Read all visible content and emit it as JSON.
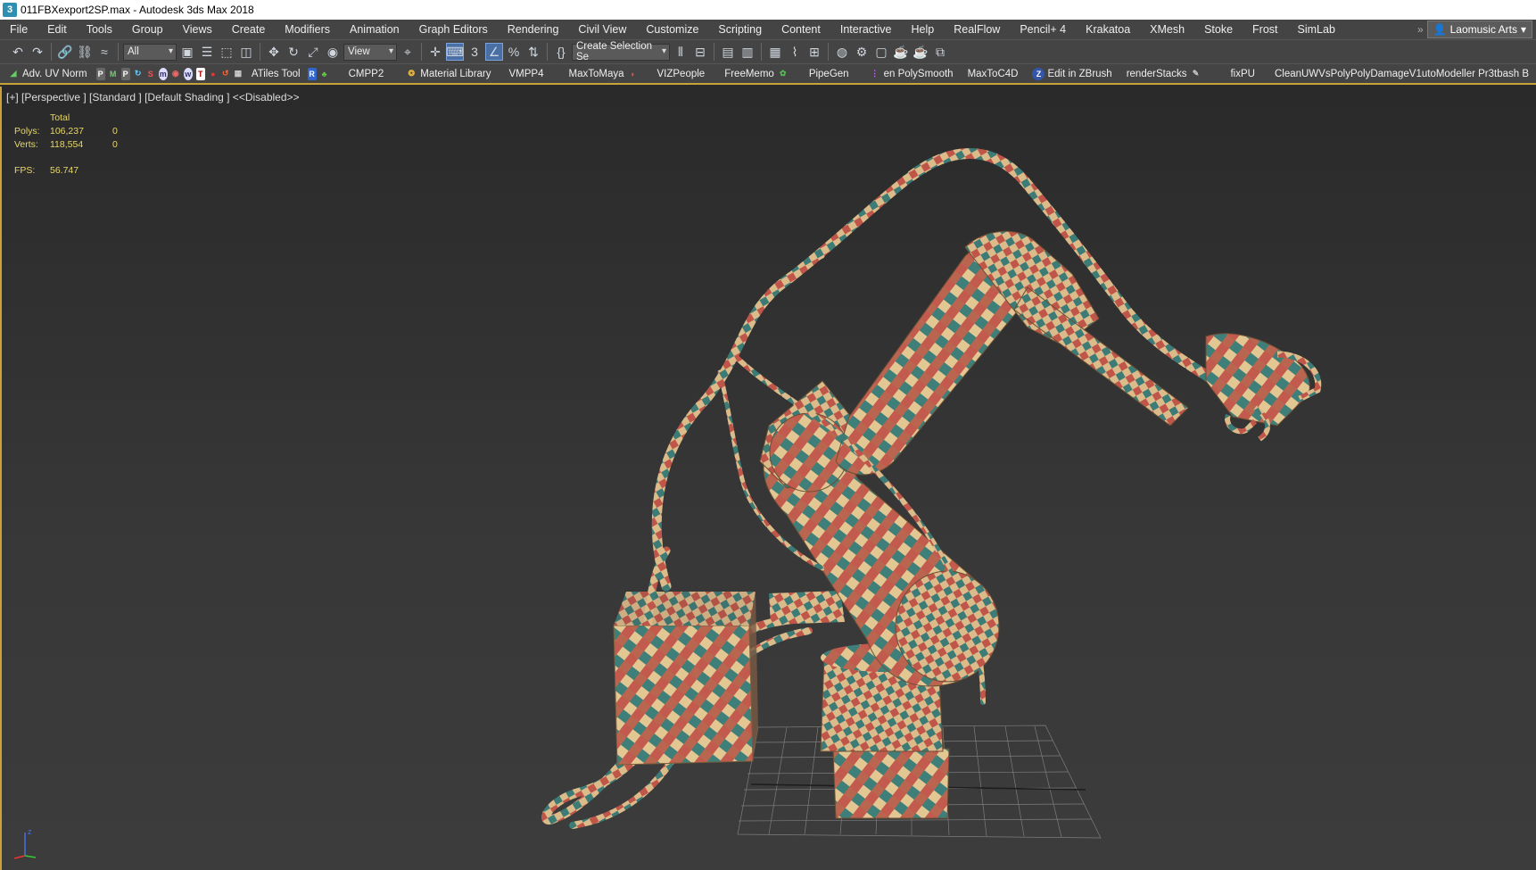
{
  "window": {
    "title": "011FBXexport2SP.max - Autodesk 3ds Max 2018",
    "app_icon_glyph": "3"
  },
  "menu": {
    "items": [
      "File",
      "Edit",
      "Tools",
      "Group",
      "Views",
      "Create",
      "Modifiers",
      "Animation",
      "Graph Editors",
      "Rendering",
      "Civil View",
      "Customize",
      "Scripting",
      "Content",
      "Interactive",
      "Help",
      "RealFlow",
      "Pencil+ 4",
      "Krakatoa",
      "XMesh",
      "Stoke",
      "Frost",
      "SimLab"
    ],
    "user": "Laomusic Arts"
  },
  "toolbar": {
    "filter_value": "All",
    "refcoord_value": "View",
    "selection_set_value": "Create Selection Se"
  },
  "plugins": {
    "items": [
      "Adv. UV Norm",
      "ATiles Tool",
      "CMPP2",
      "Material Library",
      "VMPP4",
      "MaxToMaya",
      "VIZPeople",
      "FreeMemo",
      "PipeGen",
      "en PolySmooth",
      "MaxToC4D",
      "Edit in ZBrush",
      "renderStacks",
      "fixPU",
      "CleanUWVsPolyPolyDamageV1utoModeller Pr3tbash B"
    ]
  },
  "viewport": {
    "label": "[+] [Perspective ] [Standard ] [Default Shading ]  <<Disabled>>",
    "stats": {
      "header": "Total",
      "polys_label": "Polys:",
      "polys_total": "106,237",
      "polys_sel": "0",
      "verts_label": "Verts:",
      "verts_total": "118,554",
      "verts_sel": "0",
      "fps_label": "FPS:",
      "fps_value": "56.747"
    },
    "axis_label": "z",
    "accent": "#c9a23a",
    "stats_color": "#e8d868"
  }
}
